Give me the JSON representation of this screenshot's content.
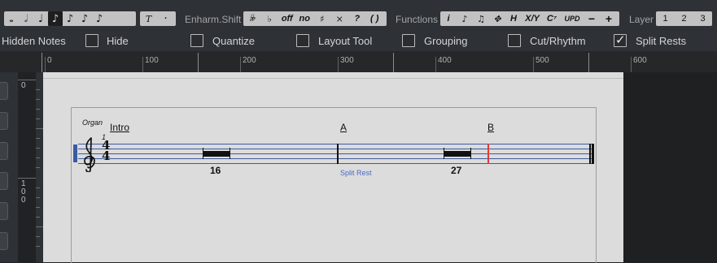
{
  "toolbar": {
    "note_values": [
      "𝅝",
      "𝅗𝅥",
      "♩",
      "♪",
      "♪",
      "♪",
      "♪"
    ],
    "note_selected_index": 3,
    "text_tools": [
      "T",
      "·"
    ],
    "enharm_label": "Enharm.Shift",
    "enharm_buttons": [
      "𝄫",
      "♭",
      "off",
      "no",
      "♯",
      "×",
      "?",
      "( )"
    ],
    "functions_label": "Functions",
    "function_buttons": [
      "i",
      "♪",
      "♫",
      "✥",
      "H",
      "X/Y",
      "C⁷",
      "UPD",
      "−",
      "+"
    ],
    "layer_label": "Layer",
    "layers": [
      "1",
      "2",
      "3"
    ]
  },
  "options": {
    "hidden_notes_label": "Hidden Notes",
    "items": [
      {
        "label": "Hide",
        "checked": false
      },
      {
        "label": "Quantize",
        "checked": false
      },
      {
        "label": "Layout Tool",
        "checked": false
      },
      {
        "label": "Grouping",
        "checked": false
      },
      {
        "label": "Cut/Rhythm",
        "checked": false
      },
      {
        "label": "Split Rests",
        "checked": true
      }
    ]
  },
  "ruler": {
    "labels": [
      "0",
      "100",
      "200",
      "300",
      "400",
      "500",
      "600"
    ]
  },
  "vruler": {
    "labels": [
      "0",
      "1",
      "0",
      "0"
    ]
  },
  "score": {
    "instrument": "Organ",
    "measure_number": "1",
    "time_signature": {
      "top": "4",
      "bottom": "4"
    },
    "markers": [
      "Intro",
      "A",
      "B"
    ],
    "rest_counts": [
      "16",
      "27"
    ],
    "split_rest_label": "Split Rest"
  },
  "colors": {
    "staff_line": "#3e5b9e",
    "split_marker": "#e03a3a",
    "split_label": "#4a6bc4",
    "checkbox_on": "#ececec"
  }
}
